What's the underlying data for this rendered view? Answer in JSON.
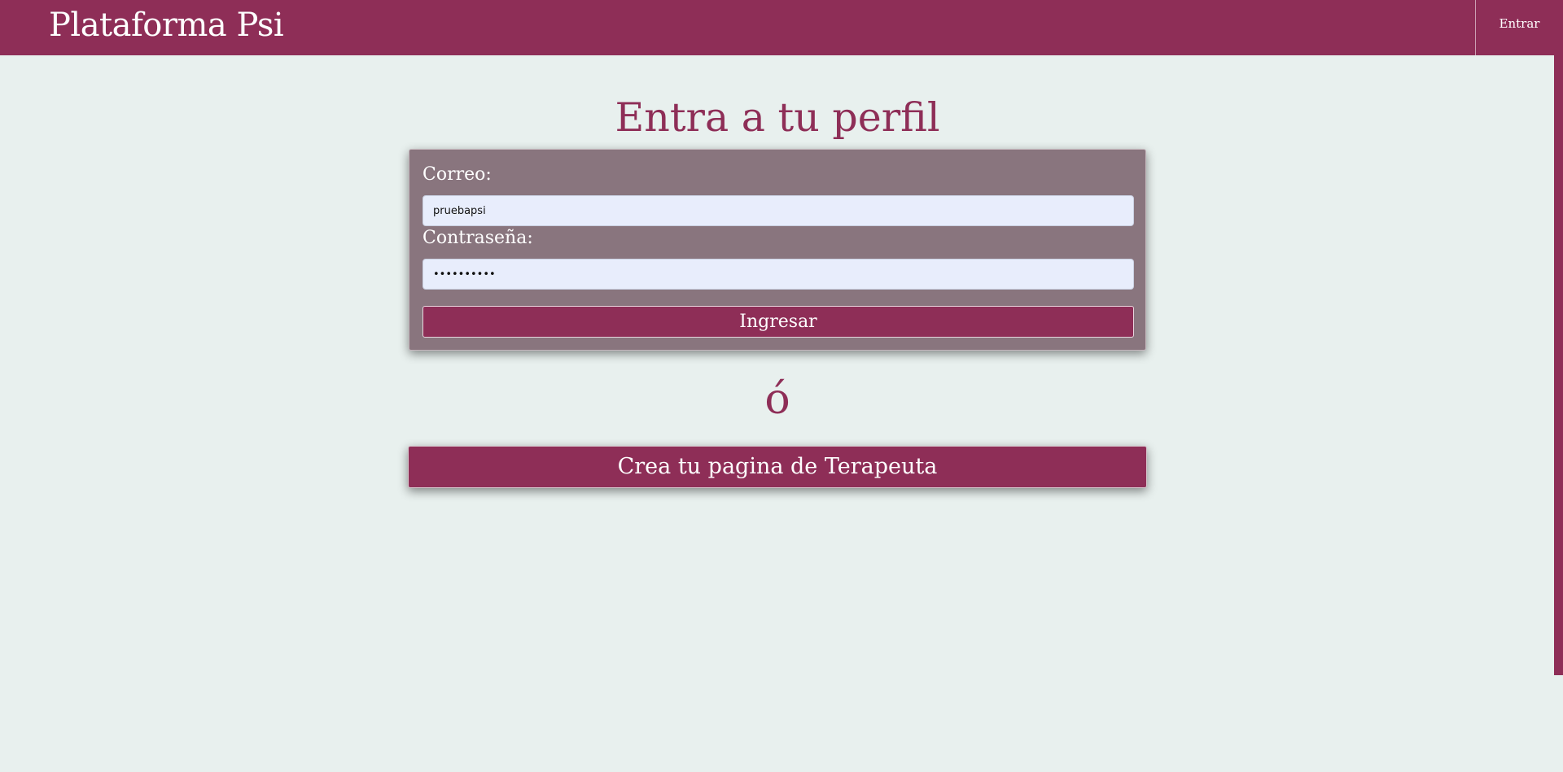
{
  "navbar": {
    "brand": "Plataforma Psi",
    "login_link": "Entrar"
  },
  "main": {
    "title": "Entra a tu perfil",
    "form": {
      "email_label": "Correo:",
      "email_value": "pruebapsi",
      "password_label": "Contraseña:",
      "password_value": "••••••••••",
      "submit_label": "Ingresar"
    },
    "separator": "ó",
    "create_button_label": "Crea tu pagina de Terapeuta"
  },
  "colors": {
    "brand": "#8e2e57",
    "background": "#e8f0ee",
    "card": "#89757e",
    "input": "#e8edfc"
  }
}
